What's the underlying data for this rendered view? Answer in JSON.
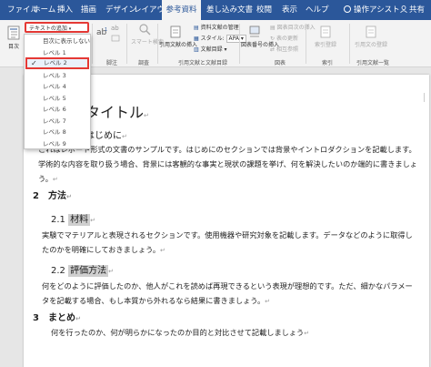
{
  "tabs": {
    "file": "ファイル",
    "home": "ホーム",
    "insert": "挿入",
    "draw": "描画",
    "design": "デザイン",
    "layout": "レイアウト",
    "references": "参考資料",
    "mailings": "差し込み文書",
    "review": "校閲",
    "view": "表示",
    "help": "ヘルプ",
    "tell_me": "操作アシスト",
    "share": "共有"
  },
  "ribbon": {
    "toc": {
      "button": "目次",
      "add_text": "テキストの追加"
    },
    "footnote": {
      "button": "脚注",
      "group": "脚注"
    },
    "research": {
      "button": "スマート検索",
      "group": "調査"
    },
    "citations": {
      "insert_citation": "引用文献の挿入",
      "manage_sources": "資料文献の管理",
      "style_label": "スタイル:",
      "style_value": "APA",
      "bibliography": "文献目録",
      "group": "引用文献と文献目録"
    },
    "captions": {
      "insert_caption": "図表番号の挿入",
      "table_of_figures": "図表目次の挿入",
      "update_table": "表の更新",
      "cross_reference": "相互参照",
      "group": "図表"
    },
    "index": {
      "mark_entry": "索引登録",
      "group": "索引"
    },
    "authorities": {
      "mark_citation": "引用文の登録",
      "group": "引用文献一覧"
    }
  },
  "dropdown": {
    "items": [
      {
        "label": "目次に表示しない",
        "checked": false
      },
      {
        "label": "レベル 1",
        "checked": false
      },
      {
        "label": "レベル 2",
        "checked": true
      },
      {
        "label": "レベル 3",
        "checked": false
      },
      {
        "label": "レベル 4",
        "checked": false
      },
      {
        "label": "レベル 5",
        "checked": false
      },
      {
        "label": "レベル 6",
        "checked": false
      },
      {
        "label": "レベル 7",
        "checked": false
      },
      {
        "label": "レベル 8",
        "checked": false
      },
      {
        "label": "レベル 9",
        "checked": false
      }
    ],
    "check_glyph": "✓"
  },
  "document": {
    "title": "タイトル",
    "heading_intro": "はじめに",
    "para_intro": "これはレポート形式の文書のサンプルです。はじめにのセクションでは背景やイントロダクションを記載します。学術的な内容を取り扱う場合、背景には客観的な事実と現状の課題を挙げ、何を解決したいのか端的に書きましょう。",
    "heading_method": "2　方法",
    "heading_materials_num": "2.1",
    "heading_materials": "材料",
    "para_materials": "実験でマテリアルと表現されるセクションです。使用機器や研究対象を記載します。データなどのように取得したのかを明確にしておきましょう。",
    "heading_eval_num": "2.2",
    "heading_eval": "評価方法",
    "para_eval": "何をどのように評価したのか、他人がこれを読めば再現できるという表現が理想的です。ただ、細かなパラメータを記載する場合、もし本質から外れるなら結果に書きましょう。",
    "heading_summary": "3　まとめ",
    "para_summary": "何を行ったのか、何が明らかになったのか目的と対比させて記載しましょう",
    "para_mark": "↵"
  },
  "colors": {
    "tab_bar": "#2b579a",
    "highlight_border": "#e53935"
  }
}
